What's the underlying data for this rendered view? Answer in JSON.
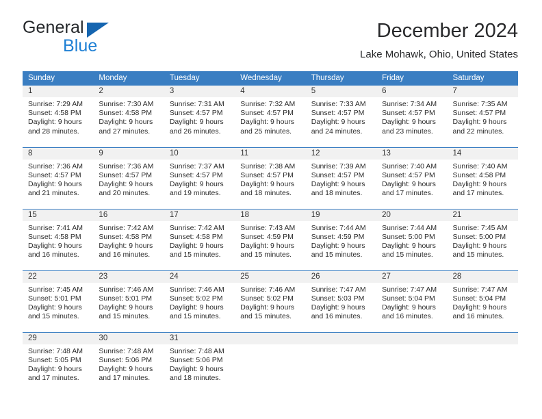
{
  "brand": {
    "name_top": "General",
    "name_bottom": "Blue",
    "triangle_color": "#1565b0",
    "blue_text_color": "#1d7fd4"
  },
  "header": {
    "title": "December 2024",
    "subtitle": "Lake Mohawk, Ohio, United States",
    "accent_color": "#3a7ec2",
    "daynum_band_color": "#f1f1f1"
  },
  "weekday_headers": [
    "Sunday",
    "Monday",
    "Tuesday",
    "Wednesday",
    "Thursday",
    "Friday",
    "Saturday"
  ],
  "weeks": [
    [
      {
        "day": "1",
        "sunrise": "Sunrise: 7:29 AM",
        "sunset": "Sunset: 4:58 PM",
        "daylight_line1": "Daylight: 9 hours",
        "daylight_line2": "and 28 minutes."
      },
      {
        "day": "2",
        "sunrise": "Sunrise: 7:30 AM",
        "sunset": "Sunset: 4:58 PM",
        "daylight_line1": "Daylight: 9 hours",
        "daylight_line2": "and 27 minutes."
      },
      {
        "day": "3",
        "sunrise": "Sunrise: 7:31 AM",
        "sunset": "Sunset: 4:57 PM",
        "daylight_line1": "Daylight: 9 hours",
        "daylight_line2": "and 26 minutes."
      },
      {
        "day": "4",
        "sunrise": "Sunrise: 7:32 AM",
        "sunset": "Sunset: 4:57 PM",
        "daylight_line1": "Daylight: 9 hours",
        "daylight_line2": "and 25 minutes."
      },
      {
        "day": "5",
        "sunrise": "Sunrise: 7:33 AM",
        "sunset": "Sunset: 4:57 PM",
        "daylight_line1": "Daylight: 9 hours",
        "daylight_line2": "and 24 minutes."
      },
      {
        "day": "6",
        "sunrise": "Sunrise: 7:34 AM",
        "sunset": "Sunset: 4:57 PM",
        "daylight_line1": "Daylight: 9 hours",
        "daylight_line2": "and 23 minutes."
      },
      {
        "day": "7",
        "sunrise": "Sunrise: 7:35 AM",
        "sunset": "Sunset: 4:57 PM",
        "daylight_line1": "Daylight: 9 hours",
        "daylight_line2": "and 22 minutes."
      }
    ],
    [
      {
        "day": "8",
        "sunrise": "Sunrise: 7:36 AM",
        "sunset": "Sunset: 4:57 PM",
        "daylight_line1": "Daylight: 9 hours",
        "daylight_line2": "and 21 minutes."
      },
      {
        "day": "9",
        "sunrise": "Sunrise: 7:36 AM",
        "sunset": "Sunset: 4:57 PM",
        "daylight_line1": "Daylight: 9 hours",
        "daylight_line2": "and 20 minutes."
      },
      {
        "day": "10",
        "sunrise": "Sunrise: 7:37 AM",
        "sunset": "Sunset: 4:57 PM",
        "daylight_line1": "Daylight: 9 hours",
        "daylight_line2": "and 19 minutes."
      },
      {
        "day": "11",
        "sunrise": "Sunrise: 7:38 AM",
        "sunset": "Sunset: 4:57 PM",
        "daylight_line1": "Daylight: 9 hours",
        "daylight_line2": "and 18 minutes."
      },
      {
        "day": "12",
        "sunrise": "Sunrise: 7:39 AM",
        "sunset": "Sunset: 4:57 PM",
        "daylight_line1": "Daylight: 9 hours",
        "daylight_line2": "and 18 minutes."
      },
      {
        "day": "13",
        "sunrise": "Sunrise: 7:40 AM",
        "sunset": "Sunset: 4:57 PM",
        "daylight_line1": "Daylight: 9 hours",
        "daylight_line2": "and 17 minutes."
      },
      {
        "day": "14",
        "sunrise": "Sunrise: 7:40 AM",
        "sunset": "Sunset: 4:58 PM",
        "daylight_line1": "Daylight: 9 hours",
        "daylight_line2": "and 17 minutes."
      }
    ],
    [
      {
        "day": "15",
        "sunrise": "Sunrise: 7:41 AM",
        "sunset": "Sunset: 4:58 PM",
        "daylight_line1": "Daylight: 9 hours",
        "daylight_line2": "and 16 minutes."
      },
      {
        "day": "16",
        "sunrise": "Sunrise: 7:42 AM",
        "sunset": "Sunset: 4:58 PM",
        "daylight_line1": "Daylight: 9 hours",
        "daylight_line2": "and 16 minutes."
      },
      {
        "day": "17",
        "sunrise": "Sunrise: 7:42 AM",
        "sunset": "Sunset: 4:58 PM",
        "daylight_line1": "Daylight: 9 hours",
        "daylight_line2": "and 15 minutes."
      },
      {
        "day": "18",
        "sunrise": "Sunrise: 7:43 AM",
        "sunset": "Sunset: 4:59 PM",
        "daylight_line1": "Daylight: 9 hours",
        "daylight_line2": "and 15 minutes."
      },
      {
        "day": "19",
        "sunrise": "Sunrise: 7:44 AM",
        "sunset": "Sunset: 4:59 PM",
        "daylight_line1": "Daylight: 9 hours",
        "daylight_line2": "and 15 minutes."
      },
      {
        "day": "20",
        "sunrise": "Sunrise: 7:44 AM",
        "sunset": "Sunset: 5:00 PM",
        "daylight_line1": "Daylight: 9 hours",
        "daylight_line2": "and 15 minutes."
      },
      {
        "day": "21",
        "sunrise": "Sunrise: 7:45 AM",
        "sunset": "Sunset: 5:00 PM",
        "daylight_line1": "Daylight: 9 hours",
        "daylight_line2": "and 15 minutes."
      }
    ],
    [
      {
        "day": "22",
        "sunrise": "Sunrise: 7:45 AM",
        "sunset": "Sunset: 5:01 PM",
        "daylight_line1": "Daylight: 9 hours",
        "daylight_line2": "and 15 minutes."
      },
      {
        "day": "23",
        "sunrise": "Sunrise: 7:46 AM",
        "sunset": "Sunset: 5:01 PM",
        "daylight_line1": "Daylight: 9 hours",
        "daylight_line2": "and 15 minutes."
      },
      {
        "day": "24",
        "sunrise": "Sunrise: 7:46 AM",
        "sunset": "Sunset: 5:02 PM",
        "daylight_line1": "Daylight: 9 hours",
        "daylight_line2": "and 15 minutes."
      },
      {
        "day": "25",
        "sunrise": "Sunrise: 7:46 AM",
        "sunset": "Sunset: 5:02 PM",
        "daylight_line1": "Daylight: 9 hours",
        "daylight_line2": "and 15 minutes."
      },
      {
        "day": "26",
        "sunrise": "Sunrise: 7:47 AM",
        "sunset": "Sunset: 5:03 PM",
        "daylight_line1": "Daylight: 9 hours",
        "daylight_line2": "and 16 minutes."
      },
      {
        "day": "27",
        "sunrise": "Sunrise: 7:47 AM",
        "sunset": "Sunset: 5:04 PM",
        "daylight_line1": "Daylight: 9 hours",
        "daylight_line2": "and 16 minutes."
      },
      {
        "day": "28",
        "sunrise": "Sunrise: 7:47 AM",
        "sunset": "Sunset: 5:04 PM",
        "daylight_line1": "Daylight: 9 hours",
        "daylight_line2": "and 16 minutes."
      }
    ],
    [
      {
        "day": "29",
        "sunrise": "Sunrise: 7:48 AM",
        "sunset": "Sunset: 5:05 PM",
        "daylight_line1": "Daylight: 9 hours",
        "daylight_line2": "and 17 minutes."
      },
      {
        "day": "30",
        "sunrise": "Sunrise: 7:48 AM",
        "sunset": "Sunset: 5:06 PM",
        "daylight_line1": "Daylight: 9 hours",
        "daylight_line2": "and 17 minutes."
      },
      {
        "day": "31",
        "sunrise": "Sunrise: 7:48 AM",
        "sunset": "Sunset: 5:06 PM",
        "daylight_line1": "Daylight: 9 hours",
        "daylight_line2": "and 18 minutes."
      },
      {
        "day": "",
        "sunrise": "",
        "sunset": "",
        "daylight_line1": "",
        "daylight_line2": ""
      },
      {
        "day": "",
        "sunrise": "",
        "sunset": "",
        "daylight_line1": "",
        "daylight_line2": ""
      },
      {
        "day": "",
        "sunrise": "",
        "sunset": "",
        "daylight_line1": "",
        "daylight_line2": ""
      },
      {
        "day": "",
        "sunrise": "",
        "sunset": "",
        "daylight_line1": "",
        "daylight_line2": ""
      }
    ]
  ]
}
